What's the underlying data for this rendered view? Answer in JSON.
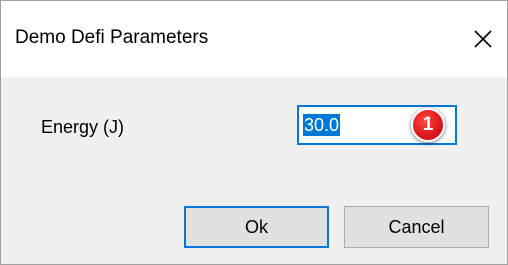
{
  "window": {
    "title": "Demo Defi Parameters",
    "close_icon": "close-icon"
  },
  "form": {
    "energy_label": "Energy (J)",
    "energy_value": "30.0"
  },
  "annotation": {
    "badge_number": "1",
    "badge_color": "#e0191f"
  },
  "buttons": {
    "ok_label": "Ok",
    "cancel_label": "Cancel"
  },
  "colors": {
    "accent": "#0078d7",
    "dialog_bg": "#f0f0f0",
    "titlebar_bg": "#ffffff"
  }
}
